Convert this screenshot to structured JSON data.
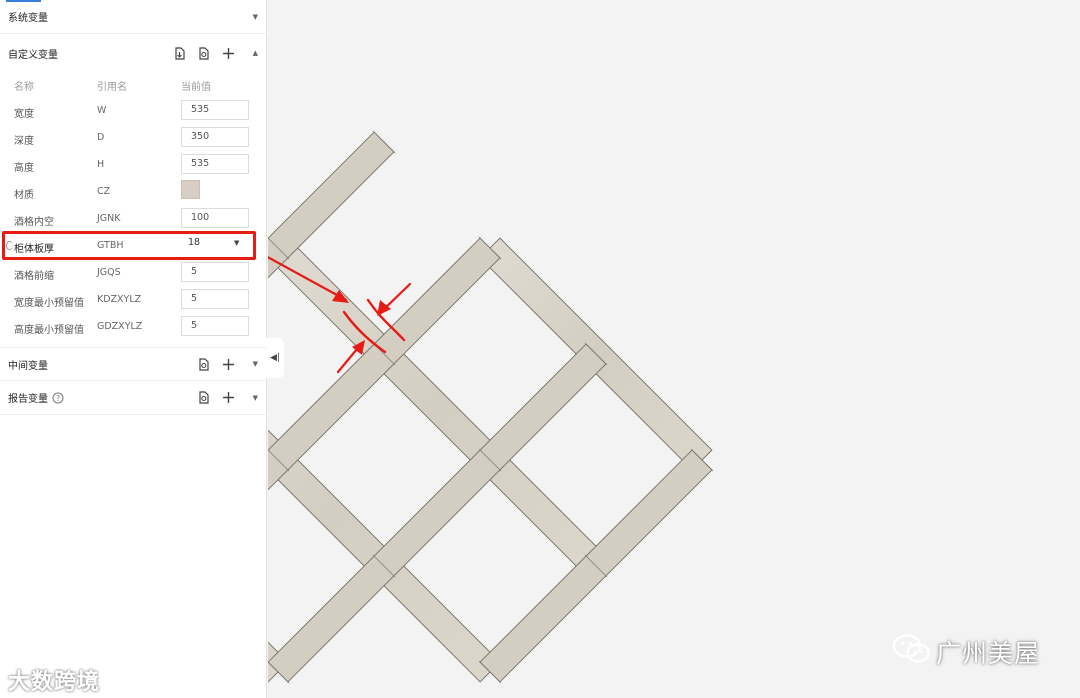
{
  "panel": {
    "system_vars": {
      "title": "系统变量"
    },
    "custom_vars": {
      "title": "自定义变量",
      "columns": {
        "name": "名称",
        "ref": "引用名",
        "value": "当前值"
      },
      "rows": [
        {
          "name": "宽度",
          "ref": "W",
          "value": "535"
        },
        {
          "name": "深度",
          "ref": "D",
          "value": "350"
        },
        {
          "name": "高度",
          "ref": "H",
          "value": "535"
        },
        {
          "name": "材质",
          "ref": "CZ",
          "value": ""
        },
        {
          "name": "酒格内空",
          "ref": "JGNK",
          "value": "100"
        },
        {
          "name": "柜体板厚",
          "ref": "GTBH",
          "value": "18"
        },
        {
          "name": "酒格前缩",
          "ref": "JGQS",
          "value": "5"
        },
        {
          "name": "宽度最小预留值",
          "ref": "KDZXYLZ",
          "value": "5"
        },
        {
          "name": "高度最小预留值",
          "ref": "GDZXYLZ",
          "value": "5"
        }
      ]
    },
    "middle_vars": {
      "title": "中间变量"
    },
    "report_vars": {
      "title": "报告变量"
    }
  },
  "icons": {
    "import": "import-icon",
    "export": "export-icon",
    "add": "plus-icon",
    "help": "help-icon",
    "collapse": "collapse-panel-icon"
  },
  "colors": {
    "highlight": "#e51b14",
    "wood": "#d9d4c9",
    "canvas_bg": "#f3f3f3"
  },
  "watermarks": {
    "left": "大数跨境",
    "right": "广州美屋"
  }
}
